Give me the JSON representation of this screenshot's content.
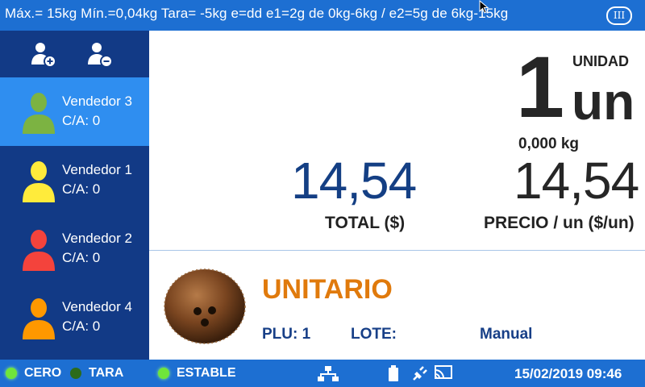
{
  "header": {
    "legal_text": "Máx.= 15kg  Mín.=0,04kg  Tara= -5kg  e=dd  e1=2g de 0kg-6kg / e2=5g de 6kg-15kg",
    "mode_badge": "III"
  },
  "sidebar": {
    "vendors": [
      {
        "name": "Vendedor 3",
        "count": "C/A: 0",
        "color": "#7cb342",
        "active": true
      },
      {
        "name": "Vendedor 1",
        "count": "C/A: 0",
        "color": "#ffeb3b",
        "active": false
      },
      {
        "name": "Vendedor 2",
        "count": "C/A: 0",
        "color": "#f4433c",
        "active": false
      },
      {
        "name": "Vendedor 4",
        "count": "C/A: 0",
        "color": "#ff9800",
        "active": false
      }
    ]
  },
  "display": {
    "unit_label": "UNIDAD",
    "quantity": "1",
    "quantity_unit": "un",
    "weight": "0,000  kg",
    "total_value": "14,54",
    "total_label": "TOTAL ($)",
    "price_value": "14,54",
    "price_label": "PRECIO / un ($/un)"
  },
  "product": {
    "type": "UNITARIO",
    "plu": "PLU: 1",
    "lote": "LOTE:",
    "mode": "Manual"
  },
  "statusbar": {
    "indicators": [
      {
        "label": "CERO",
        "on": true
      },
      {
        "label": "TARA",
        "on": false
      },
      {
        "label": "ESTABLE",
        "on": true
      }
    ],
    "datetime": "15/02/2019  09:46"
  },
  "colors": {
    "bar_blue": "#1d6fd2",
    "sidebar_navy": "#123a86",
    "sidebar_active": "#2f8ef0",
    "total_blue": "#143f84",
    "product_orange": "#e07a0c"
  }
}
